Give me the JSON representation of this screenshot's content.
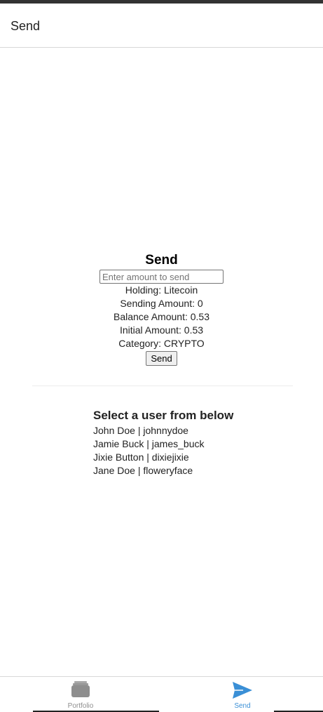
{
  "header": {
    "title": "Send"
  },
  "send_panel": {
    "heading": "Send",
    "amount_placeholder": "Enter amount to send",
    "holding": "Holding: Litecoin",
    "sending_amount": "Sending Amount: 0",
    "balance_amount": "Balance Amount: 0.53",
    "initial_amount": "Initial Amount: 0.53",
    "category": "Category: CRYPTO",
    "send_button_label": "Send"
  },
  "users": {
    "heading": "Select a user from below",
    "items": [
      {
        "label": "John Doe | johnnydoe"
      },
      {
        "label": "Jamie Buck | james_buck"
      },
      {
        "label": "Jixie Button | dixiejixie"
      },
      {
        "label": "Jane Doe | floweryface"
      }
    ]
  },
  "tabs": [
    {
      "label": "Portfolio",
      "icon": "portfolio-icon",
      "active": false
    },
    {
      "label": "Send",
      "icon": "send-icon",
      "active": true
    }
  ],
  "colors": {
    "active_tab": "#3a8fd6",
    "inactive_tab": "#8e8e8e"
  }
}
